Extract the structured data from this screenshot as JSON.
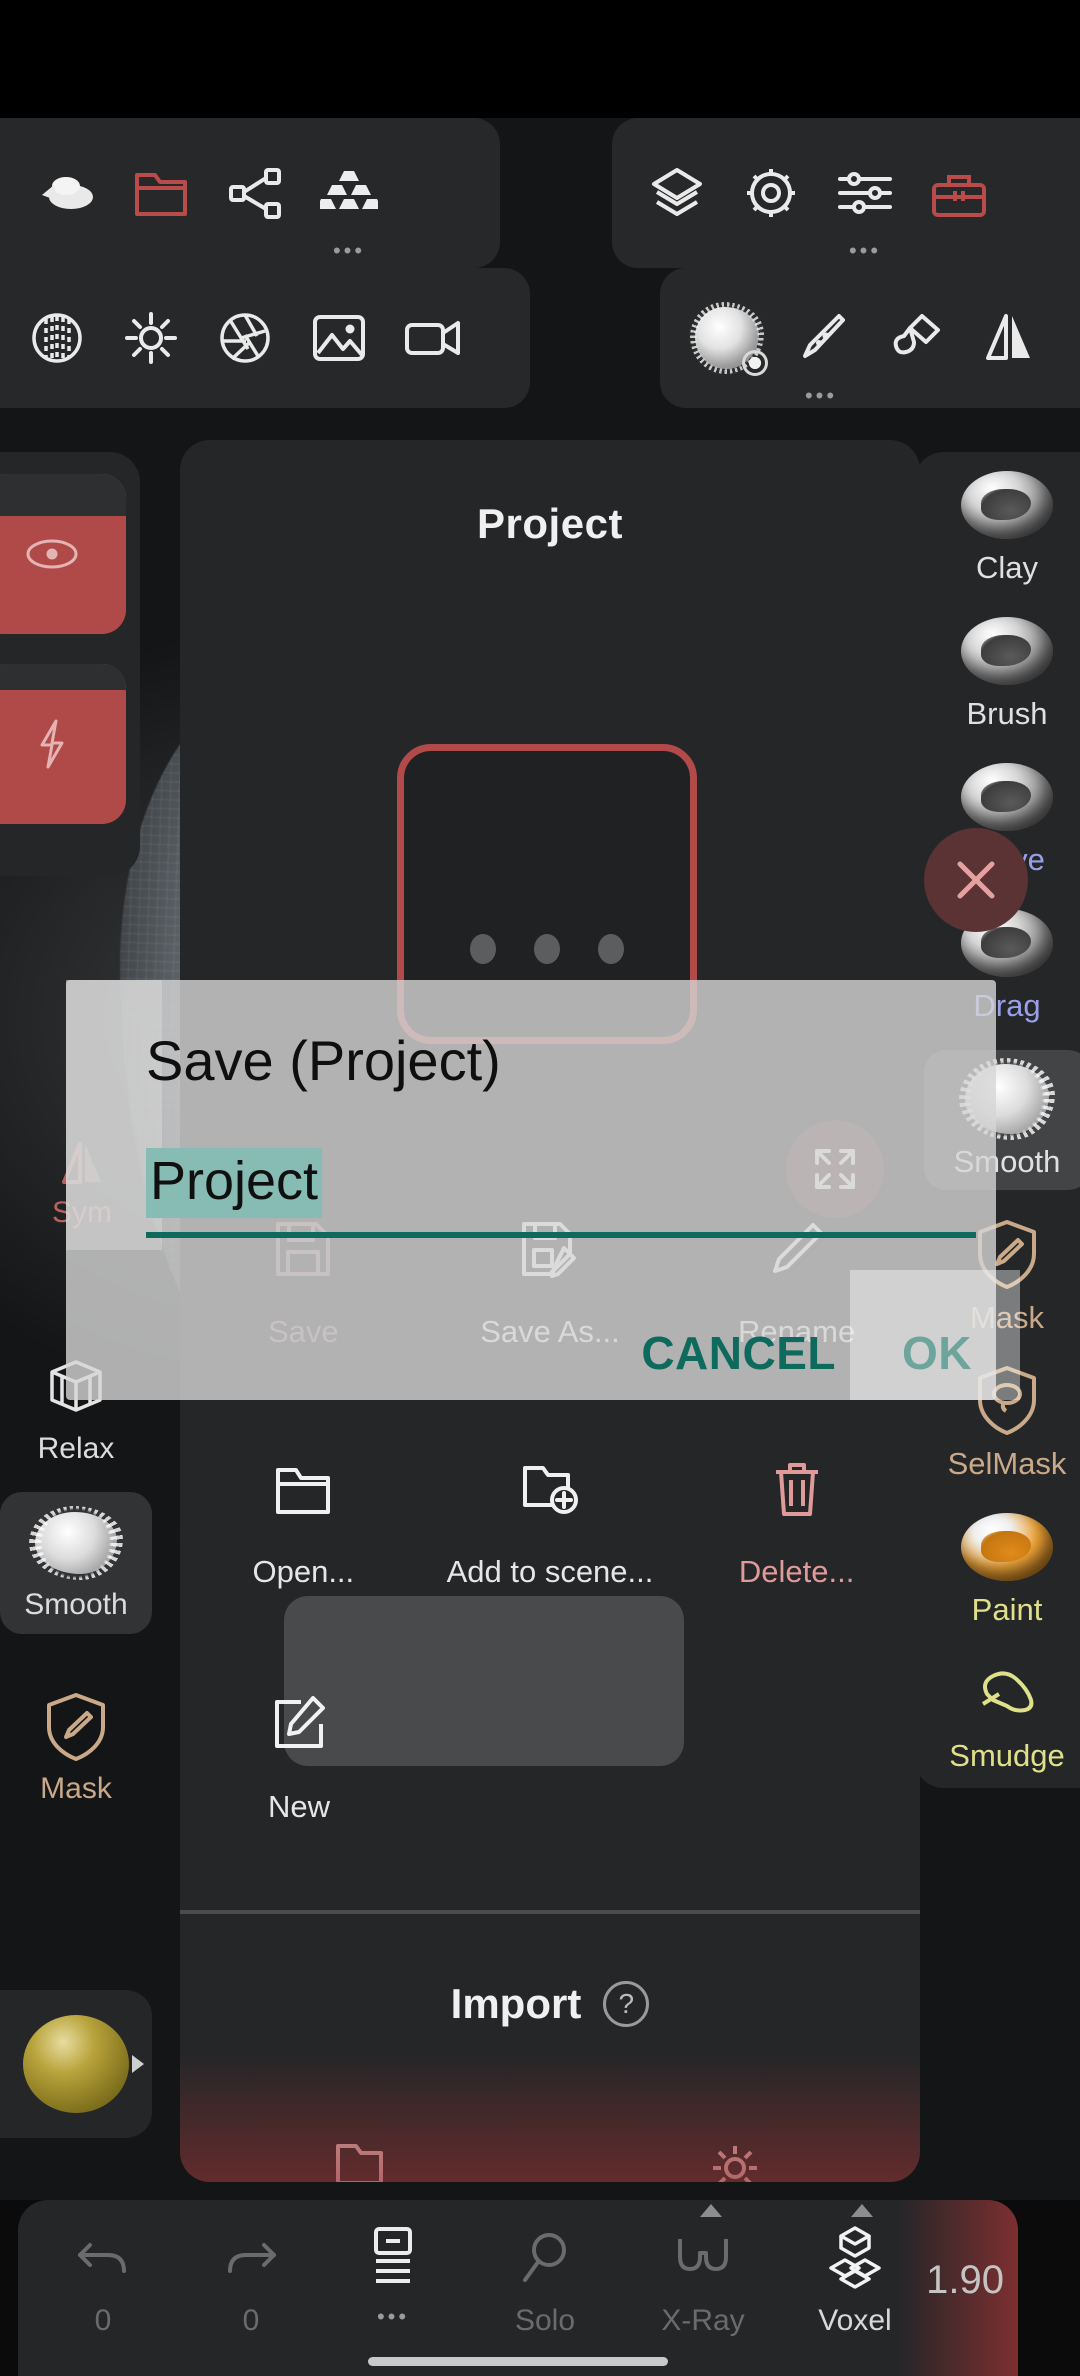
{
  "app": {
    "zoom_value": "1.90"
  },
  "toolbar_top": {
    "left_items": [
      {
        "label": "sculpt-mode",
        "icon": "blob-shape-icon"
      },
      {
        "label": "files",
        "icon": "folder-open-icon",
        "accent": true
      },
      {
        "label": "scene-graph",
        "icon": "share-nodes-icon"
      },
      {
        "label": "topology",
        "icon": "stacked-bars-icon",
        "has_more": true
      }
    ],
    "right_items": [
      {
        "label": "layers",
        "icon": "layers-icon"
      },
      {
        "label": "settings",
        "icon": "gear-icon"
      },
      {
        "label": "sliders",
        "icon": "sliders-icon",
        "has_more": true
      },
      {
        "label": "toolbox",
        "icon": "toolbox-icon",
        "accent": true
      }
    ],
    "row2_left_items": [
      {
        "label": "grid-sphere",
        "icon": "grid-sphere-icon"
      },
      {
        "label": "lighting",
        "icon": "sun-icon"
      },
      {
        "label": "post-process",
        "icon": "aperture-icon"
      },
      {
        "label": "background-image",
        "icon": "picture-icon"
      },
      {
        "label": "video",
        "icon": "video-camera-icon"
      }
    ],
    "row2_right_items": [
      {
        "label": "brush-settings",
        "icon": "rock-blob-gear-icon"
      },
      {
        "label": "pen-pressure",
        "icon": "pen-icon",
        "has_more": true
      },
      {
        "label": "paint-fill",
        "icon": "paint-brush-icon"
      },
      {
        "label": "symmetry",
        "icon": "mirror-triangle-icon"
      }
    ]
  },
  "left_column": {
    "slots": [
      {
        "name": "radius-slot",
        "icon": "target-dot-icon"
      },
      {
        "name": "intensity-slot",
        "icon": "lightning-bolt-icon"
      }
    ],
    "symmetry": {
      "label": "Sym",
      "icon": "mirror-triangle-icon"
    },
    "tools": [
      {
        "label": "Relax",
        "icon": "wireframe-cube-icon",
        "selected": false
      },
      {
        "label": "Smooth",
        "icon": "rock-blob-icon",
        "selected": true
      },
      {
        "label": "Mask",
        "icon": "shield-brush-icon",
        "style": "gold"
      }
    ],
    "material_swatch": "sphere-material-swatch"
  },
  "right_column": {
    "tools": [
      {
        "label": "Clay",
        "icon": "clay-ball-icon",
        "style": "plain"
      },
      {
        "label": "Brush",
        "icon": "brush-ball-icon",
        "style": "plain"
      },
      {
        "label": "Move",
        "icon": "move-ball-icon",
        "style": "violet"
      },
      {
        "label": "Drag",
        "icon": "drag-ball-icon",
        "style": "violet"
      },
      {
        "label": "Smooth",
        "icon": "rock-blob-icon",
        "style": "plain",
        "selected": true
      },
      {
        "label": "Mask",
        "icon": "shield-brush-icon",
        "style": "gold"
      },
      {
        "label": "SelMask",
        "icon": "shield-lasso-icon",
        "style": "gold"
      },
      {
        "label": "Paint",
        "icon": "paint-ball-icon",
        "style": "yellow"
      },
      {
        "label": "Smudge",
        "icon": "smudge-hand-icon",
        "style": "yellow"
      }
    ],
    "close_button": {
      "name": "close-button",
      "icon": "close-x-icon"
    }
  },
  "center_panel": {
    "title": "Project",
    "fullscreen_button": "expand-arrows-icon",
    "file_actions_row1": [
      {
        "label": "Save",
        "icon": "floppy-disk-icon",
        "state": "disabled"
      },
      {
        "label": "Save As...",
        "icon": "floppy-pencil-icon",
        "state": "enabled"
      },
      {
        "label": "Rename",
        "icon": "pencil-icon",
        "state": "enabled"
      }
    ],
    "file_actions_row2": [
      {
        "label": "Open...",
        "icon": "folder-open-icon"
      },
      {
        "label": "Add to scene...",
        "icon": "folder-plus-icon"
      },
      {
        "label": "Delete...",
        "icon": "trash-icon",
        "style": "red"
      }
    ],
    "file_actions_row3": [
      {
        "label": "New",
        "icon": "note-pencil-icon"
      }
    ],
    "import_section": {
      "title": "Import",
      "help_icon": "question-circle-icon",
      "items": [
        {
          "label": "",
          "icon": "folder-import-icon"
        },
        {
          "label": "",
          "icon": "gear-import-icon"
        }
      ]
    }
  },
  "dialog": {
    "title": "Save (Project)",
    "input_value": "Project",
    "cancel_label": "CANCEL",
    "ok_label": "OK",
    "accent_color": "#0d6a5c",
    "selection_color": "#86bcb4"
  },
  "bottom_bar": {
    "items": [
      {
        "label": "0",
        "icon": "undo-arrow-icon",
        "style": "dim"
      },
      {
        "label": "0",
        "icon": "redo-arrow-icon",
        "style": "dim"
      },
      {
        "label": "",
        "icon": "layers-list-icon",
        "has_more": true
      },
      {
        "label": "Solo",
        "icon": "magnifier-icon",
        "style": "dim"
      },
      {
        "label": "X-Ray",
        "icon": "xray-glasses-icon",
        "style": "dim"
      },
      {
        "label": "Voxel",
        "icon": "voxel-cubes-icon",
        "style": "active"
      }
    ],
    "zoom_value": "1.90"
  }
}
